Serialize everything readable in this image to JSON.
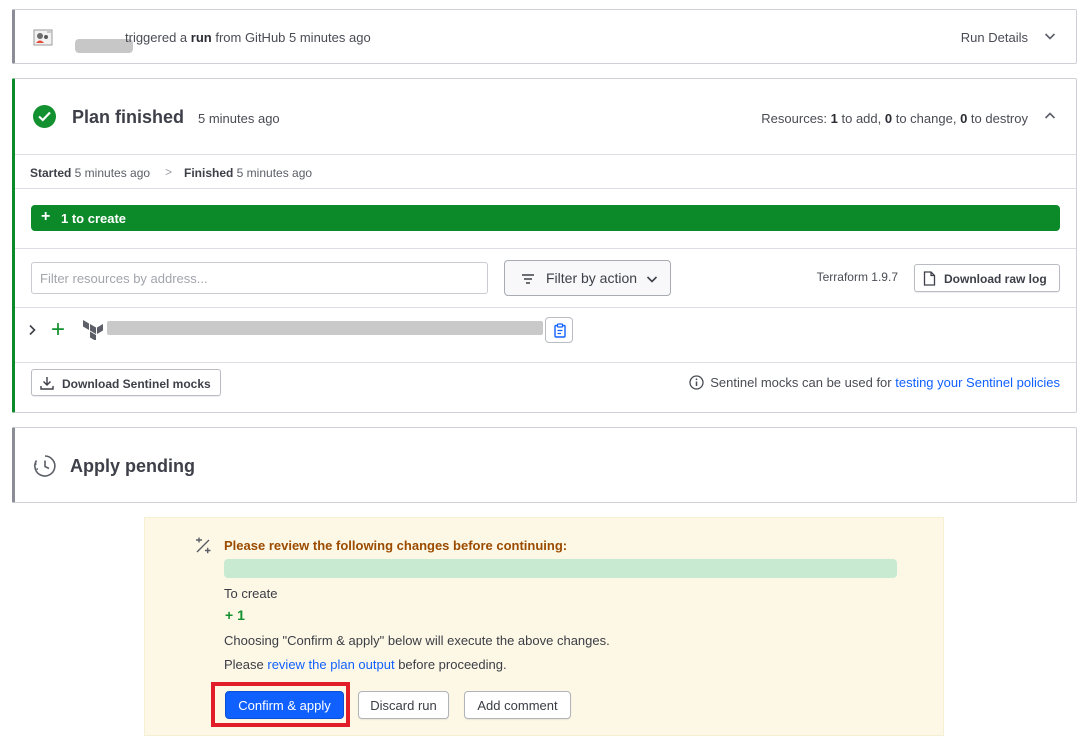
{
  "trigger": {
    "text_pre": "triggered a ",
    "text_run": "run",
    "text_post": " from GitHub 5 minutes ago",
    "run_details_label": "Run Details",
    "avatar_icon": "user-avatar-icon",
    "chevron_icon": "chevron-down-icon"
  },
  "plan": {
    "title": "Plan finished",
    "time": "5 minutes ago",
    "resources": {
      "prefix": "Resources: ",
      "add_count": "1",
      "add_label": " to add, ",
      "change_count": "0",
      "change_label": " to change, ",
      "destroy_count": "0",
      "destroy_label": " to destroy"
    },
    "timing": {
      "started_label": "Started",
      "started_time": " 5 minutes ago",
      "separator": ">",
      "finished_label": "Finished",
      "finished_time": " 5 minutes ago"
    },
    "create_bar": {
      "plus": "+",
      "label": "1 to create"
    },
    "filter": {
      "placeholder": "Filter resources by address...",
      "action_label": "Filter by action"
    },
    "terraform_version": "Terraform 1.9.7",
    "download_raw_log_label": "Download raw log",
    "resource_row": {
      "plus": "+"
    },
    "download_mocks_label": "Download Sentinel mocks",
    "mocks_info_text": "Sentinel mocks can be used for ",
    "mocks_info_link": "testing your Sentinel policies"
  },
  "apply": {
    "title": "Apply pending"
  },
  "review": {
    "heading": "Please review the following changes before continuing:",
    "to_create_label": "To create",
    "to_create_count": "+ 1",
    "choosing_text": "Choosing \"Confirm & apply\" below will execute the above changes.",
    "please_pre": "Please ",
    "please_link": "review the plan output",
    "please_post": " before proceeding.",
    "confirm_label": "Confirm & apply",
    "discard_label": "Discard run",
    "comment_label": "Add comment"
  },
  "colors": {
    "success_green": "#0c8a2a",
    "link_blue": "#1060ff",
    "warning_bg": "#fdf8e6",
    "warning_text": "#9a4b00",
    "highlight_red": "#e11d2a"
  }
}
